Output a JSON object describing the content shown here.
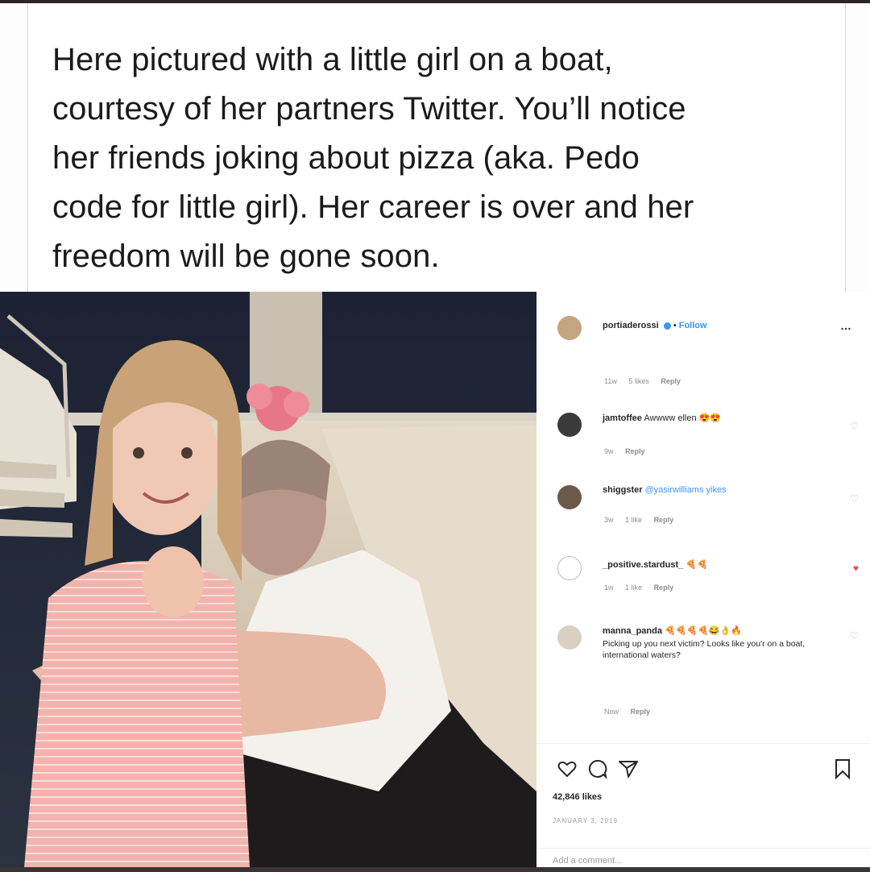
{
  "caption": {
    "lines": [
      "Here pictured with a little girl on a boat,",
      "courtesy of her partners Twitter. You’ll notice",
      "her friends joking about pizza (aka. Pedo",
      "code for little girl). Her career is over and her",
      "freedom will be gone soon."
    ]
  },
  "post": {
    "owner": "portiaderossi",
    "verified_icon": "verified-badge-icon",
    "follow_label": "Follow",
    "separator": "•",
    "more_icon": "more-options-icon",
    "owner_comment_meta": {
      "time": "11w",
      "likes": "5 likes",
      "reply": "Reply"
    },
    "comments": [
      {
        "user": "jamtoffee",
        "text": "Awwww ellen",
        "emoji": "😍😍",
        "time": "9w",
        "likes": "",
        "reply": "Reply",
        "liked": false
      },
      {
        "user": "shiggster",
        "text": "@yasirwilliams yikes",
        "emoji": "",
        "time": "3w",
        "likes": "1 like",
        "reply": "Reply",
        "liked": false
      },
      {
        "user": "_positive.stardust_",
        "text": "",
        "emoji": "🍕🍕",
        "time": "1w",
        "likes": "1 like",
        "reply": "Reply",
        "liked": true
      },
      {
        "user": "manna_panda",
        "text": "Picking up you next victim? Looks like you'r on a boat, international waters?",
        "emoji": "🍕🍕🍕🍕😂👌🔥",
        "time": "Now",
        "likes": "",
        "reply": "Reply",
        "liked": false
      }
    ],
    "likes": "42,846 likes",
    "date": "JANUARY 3, 2019",
    "add_comment_placeholder": "Add a comment..."
  },
  "colors": {
    "caption_text": "#1b1b1b",
    "link_blue": "#3897f0",
    "like_red": "#ed4956",
    "meta_grey": "#8e8e8e"
  }
}
